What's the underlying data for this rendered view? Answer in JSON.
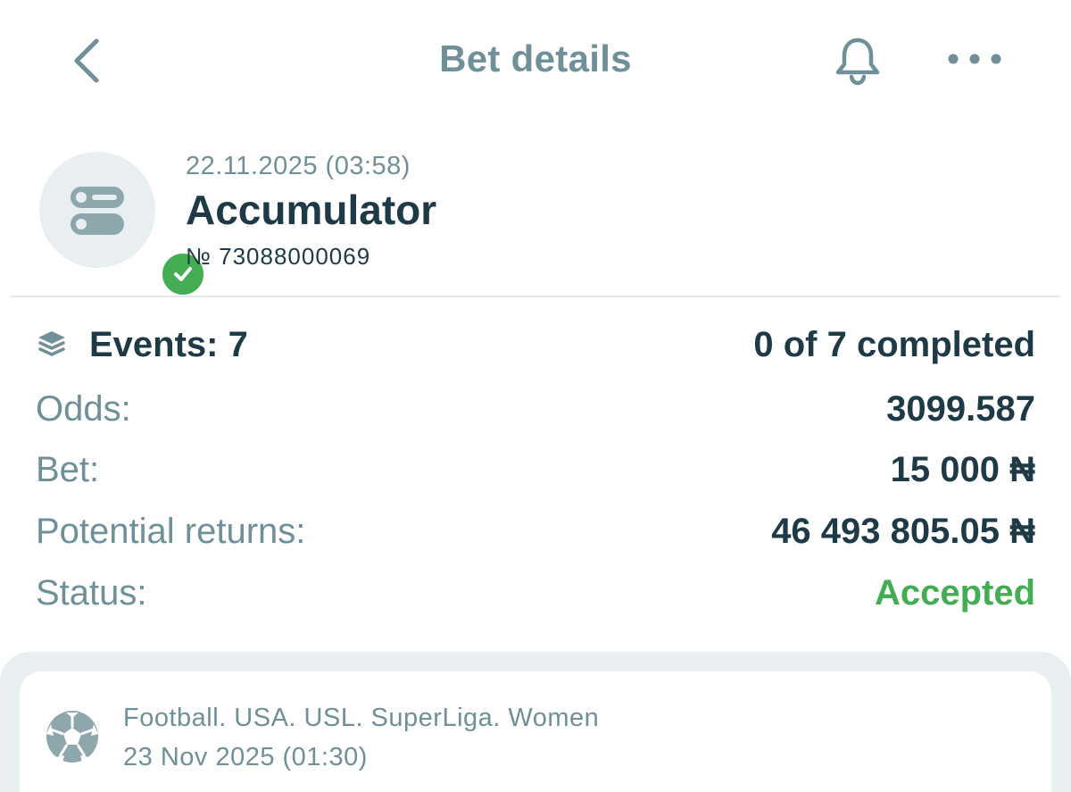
{
  "header": {
    "title": "Bet details",
    "back_icon": "chevron-left-icon",
    "bell_icon": "bell-icon",
    "more_icon": "more-horizontal-icon"
  },
  "bet": {
    "date": "22.11.2025 (03:58)",
    "type": "Accumulator",
    "number": "№ 73088000069",
    "type_icon": "accumulator-icon",
    "status_icon": "check-circle-icon"
  },
  "details": {
    "events_label": "Events: 7",
    "events_progress": "0 of 7 completed",
    "events_icon": "layers-icon",
    "odds_label": "Odds:",
    "odds_value": "3099.587",
    "bet_label": "Bet:",
    "bet_value": "15 000 ₦",
    "returns_label": "Potential returns:",
    "returns_value": "46 493 805.05 ₦",
    "status_label": "Status:",
    "status_value": "Accepted"
  },
  "event": {
    "league": "Football. USA. USL. SuperLiga. Women",
    "date": "23 Nov 2025 (01:30)",
    "sport_icon": "football-icon"
  },
  "colors": {
    "accent_text": "#6f9098",
    "primary_text": "#1e3a46",
    "success": "#44ac52",
    "surface": "#e9eff1"
  }
}
